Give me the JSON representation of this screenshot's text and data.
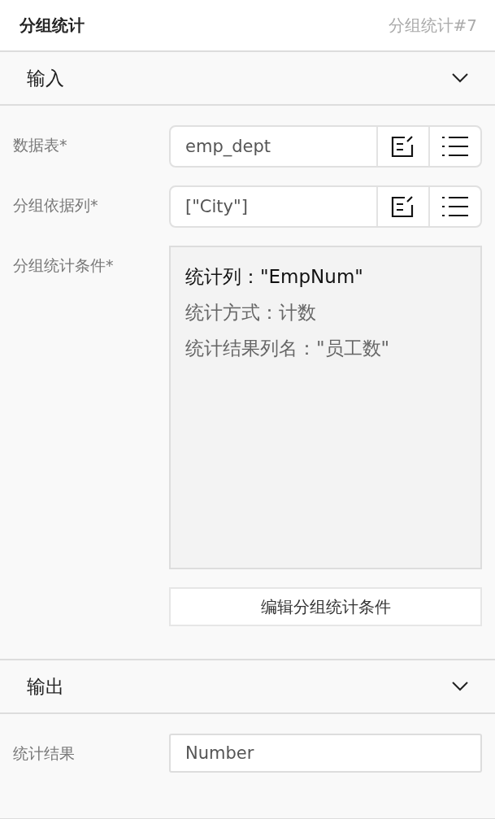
{
  "header": {
    "title": "分组统计",
    "instance": "分组统计#7"
  },
  "sections": [
    {
      "title": "输入",
      "expanded": true,
      "fields": [
        {
          "kind": "picker",
          "label": "数据表*",
          "value": "emp_dept"
        },
        {
          "kind": "picker",
          "label": "分组依据列*",
          "value": "[\"City\"]"
        },
        {
          "kind": "conditions",
          "label": "分组统计条件*",
          "lines": [
            {
              "text": "统计列：\"EmpNum\"",
              "kind": "main"
            },
            {
              "text": "统计方式：计数",
              "kind": "detail"
            },
            {
              "text": "统计结果列名：\"员工数\"",
              "kind": "detail"
            }
          ],
          "button": "编辑分组统计条件"
        }
      ]
    },
    {
      "title": "输出",
      "expanded": true,
      "fields": [
        {
          "kind": "text",
          "label": "统计结果",
          "value": "Number"
        }
      ]
    }
  ]
}
